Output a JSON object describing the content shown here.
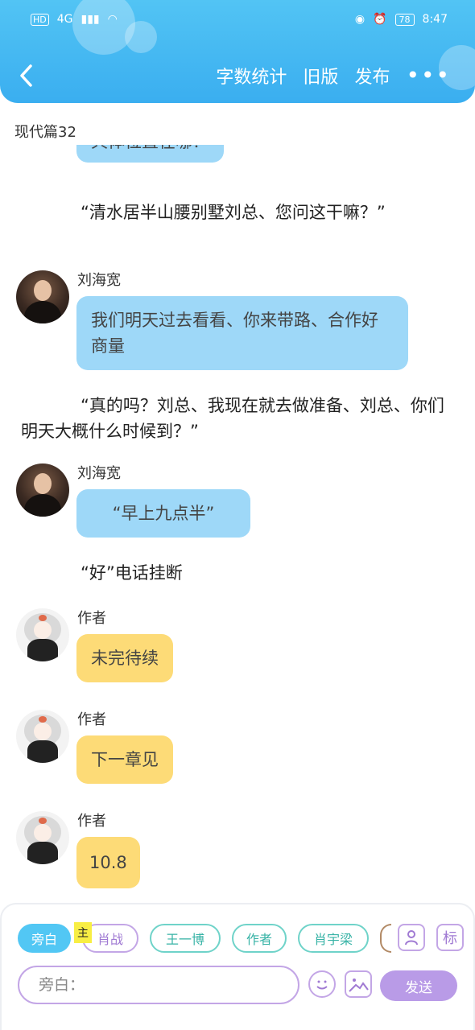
{
  "status_bar": {
    "signal": "4G",
    "battery": "78",
    "time": "8:47"
  },
  "header": {
    "word_count": "字数统计",
    "old_version": "旧版",
    "publish": "发布",
    "more": "•••"
  },
  "chapter_title": "现代篇32",
  "chat": {
    "cut_bubble": "具体位置在哪？",
    "narration_1": "“清水居半山腰别墅刘总、您问这干嘛？”",
    "msg1": {
      "name": "刘海宽",
      "text": "我们明天过去看看、你来带路、合作好商量"
    },
    "narration_2": "“真的吗？刘总、我现在就去做准备、刘总、你们明天大概什么时候到？”",
    "msg2": {
      "name": "刘海宽",
      "text": "“早上九点半”"
    },
    "narration_3": "“好”电话挂断",
    "msg3": {
      "name": "作者",
      "text": "未完待续"
    },
    "msg4": {
      "name": "作者",
      "text": "下一章见"
    },
    "msg5": {
      "name": "作者",
      "text": "10.8"
    }
  },
  "composer": {
    "chips": [
      "旁白",
      "肖战",
      "王一博",
      "作者",
      "肖宇梁"
    ],
    "marker": "主",
    "input_placeholder": "旁白：",
    "mark_label": "标",
    "send_label": "发送"
  },
  "colors": {
    "header": "#3aaef0",
    "blue_bubble": "#9ed8f8",
    "yellow_bubble": "#fddb77",
    "accent_purple": "#b99be7"
  }
}
